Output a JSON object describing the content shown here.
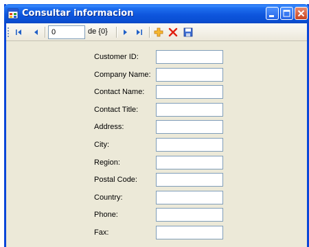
{
  "window": {
    "title": "Consultar informacion"
  },
  "navigator": {
    "position_value": "0",
    "count_label": "de {0}"
  },
  "form": {
    "fields": [
      {
        "label": "Customer ID:",
        "value": ""
      },
      {
        "label": "Company Name:",
        "value": ""
      },
      {
        "label": "Contact Name:",
        "value": ""
      },
      {
        "label": "Contact Title:",
        "value": ""
      },
      {
        "label": "Address:",
        "value": ""
      },
      {
        "label": "City:",
        "value": ""
      },
      {
        "label": "Region:",
        "value": ""
      },
      {
        "label": "Postal Code:",
        "value": ""
      },
      {
        "label": "Country:",
        "value": ""
      },
      {
        "label": "Phone:",
        "value": ""
      },
      {
        "label": "Fax:",
        "value": ""
      }
    ]
  },
  "colors": {
    "titlebar": "#0a4fd4",
    "window_background": "#ece9d8",
    "input_border": "#7f9db9",
    "add_icon": "#f0a020",
    "delete_icon": "#e02010",
    "save_icon": "#3060c0"
  },
  "icons": [
    "app-icon",
    "move-first-icon",
    "move-previous-icon",
    "move-next-icon",
    "move-last-icon",
    "add-new-icon",
    "delete-icon",
    "save-icon"
  ]
}
